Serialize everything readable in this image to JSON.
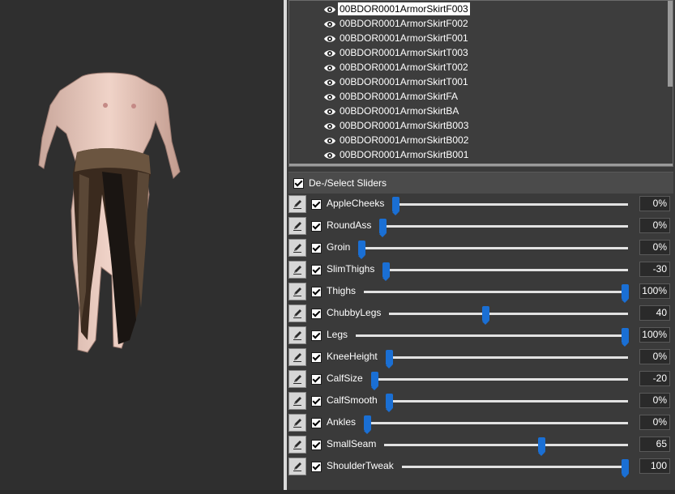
{
  "tree": {
    "items": [
      {
        "label": "00BDOR0001ArmorSkirtF003",
        "selected": true
      },
      {
        "label": "00BDOR0001ArmorSkirtF002"
      },
      {
        "label": "00BDOR0001ArmorSkirtF001"
      },
      {
        "label": "00BDOR0001ArmorSkirtT003"
      },
      {
        "label": "00BDOR0001ArmorSkirtT002"
      },
      {
        "label": "00BDOR0001ArmorSkirtT001"
      },
      {
        "label": "00BDOR0001ArmorSkirtFA"
      },
      {
        "label": "00BDOR0001ArmorSkirtBA"
      },
      {
        "label": "00BDOR0001ArmorSkirtB003"
      },
      {
        "label": "00BDOR0001ArmorSkirtB002"
      },
      {
        "label": "00BDOR0001ArmorSkirtB001"
      }
    ]
  },
  "header": {
    "label": "De-/Select Sliders",
    "checked": true
  },
  "sliders": [
    {
      "label": "AppleCheeks",
      "value": "0%",
      "checked": true,
      "level": 0
    },
    {
      "label": "RoundAss",
      "value": "0%",
      "checked": true,
      "level": 0
    },
    {
      "label": "Groin",
      "value": "0%",
      "checked": true,
      "level": 0
    },
    {
      "label": "SlimThighs",
      "value": "-30",
      "checked": true,
      "level": 0
    },
    {
      "label": "Thighs",
      "value": "100%",
      "checked": true,
      "level": 1
    },
    {
      "label": "ChubbyLegs",
      "value": "40",
      "checked": true,
      "level": 0.4
    },
    {
      "label": "Legs",
      "value": "100%",
      "checked": true,
      "level": 1
    },
    {
      "label": "KneeHeight",
      "value": "0%",
      "checked": true,
      "level": 0
    },
    {
      "label": "CalfSize",
      "value": "-20",
      "checked": true,
      "level": 0
    },
    {
      "label": "CalfSmooth",
      "value": "0%",
      "checked": true,
      "level": 0
    },
    {
      "label": "Ankles",
      "value": "0%",
      "checked": true,
      "level": 0
    },
    {
      "label": "SmallSeam",
      "value": "65",
      "checked": true,
      "level": 0.65
    },
    {
      "label": "ShoulderTweak",
      "value": "100",
      "checked": true,
      "level": 1
    }
  ],
  "colors": {
    "accent": "#1a6fd4",
    "panel": "#3a3a3a",
    "viewport": "#2f2f2f"
  },
  "icons": {
    "tree_item": "eye-icon",
    "row_button": "pencil-icon"
  }
}
